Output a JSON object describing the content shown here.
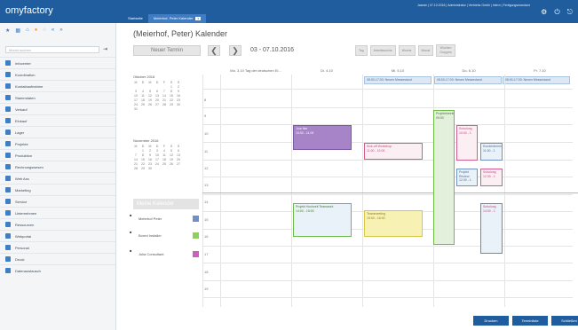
{
  "app": {
    "brand": "myfactory"
  },
  "topbar": {
    "tabs": [
      {
        "label": "Startseite",
        "active": false
      },
      {
        "label": "Meierhof, Peter Kalender",
        "active": true,
        "badge": "x"
      }
    ],
    "userinfo": "Jasmin | 07.10.2016 | Administrator | Vertriebs Gmbh | Intern | Fertigungsmandant",
    "icons": [
      "gear-icon",
      "power-icon",
      "exit-icon"
    ]
  },
  "sidebar": {
    "icons": [
      "star-icon",
      "bar-chart-icon",
      "home-icon",
      "palette-icon",
      "circle-icon",
      "prev-icon",
      "next-icon"
    ],
    "search_placeholder": "Modul suchen",
    "search_button": "⇥",
    "items": [
      "Infocenter",
      "Koordination",
      "Kontaktaufnahme",
      "Stammdaten",
      "Verkauf",
      "Einkauf",
      "Lager",
      "Projekte",
      "Produktion",
      "Rechnungswesen",
      "Web Ass",
      "Marketing",
      "Service",
      "Unternehmen",
      "Ressourcen",
      "Webportal",
      "Personal",
      "Druck",
      "Datenaustausch"
    ]
  },
  "header": {
    "title": "(Meierhof, Peter) Kalender",
    "new_appointment": "Neuer Termin",
    "prev": "❮",
    "next": "❯",
    "daterange": "03 - 07.10.2016",
    "views": [
      "Tag",
      "Arbeitswoche",
      "Woche",
      "Monat"
    ],
    "view_tall": [
      "Wochen",
      "Gruppen"
    ]
  },
  "mini_oct": {
    "title": "Oktober 2016",
    "weekdays": [
      "M",
      "D",
      "M",
      "D",
      "F",
      "S",
      "S"
    ],
    "rows": [
      [
        "",
        "",
        "",
        "",
        "",
        "1",
        "2"
      ],
      [
        "3",
        "4",
        "5",
        "6",
        "7",
        "8",
        "9"
      ],
      [
        "10",
        "11",
        "12",
        "13",
        "14",
        "15",
        "16"
      ],
      [
        "17",
        "18",
        "19",
        "20",
        "21",
        "22",
        "23"
      ],
      [
        "24",
        "25",
        "26",
        "27",
        "28",
        "29",
        "30"
      ],
      [
        "31",
        "",
        "",
        "",
        "",
        "",
        ""
      ]
    ]
  },
  "mini_nov": {
    "title": "November 2016",
    "weekdays": [
      "M",
      "D",
      "M",
      "D",
      "F",
      "S",
      "S"
    ],
    "rows": [
      [
        "",
        "1",
        "2",
        "3",
        "4",
        "5",
        "6"
      ],
      [
        "7",
        "8",
        "9",
        "10",
        "11",
        "12",
        "13"
      ],
      [
        "14",
        "15",
        "16",
        "17",
        "18",
        "19",
        "20"
      ],
      [
        "21",
        "22",
        "23",
        "24",
        "25",
        "26",
        "27"
      ],
      [
        "28",
        "29",
        "30",
        "",
        "",
        "",
        ""
      ]
    ]
  },
  "my_calendars": {
    "title": "Meine Kalender",
    "items": [
      {
        "name": "Meierhof Peter",
        "color": "#6f8fc8"
      },
      {
        "name": "Bored Installer",
        "color": "#8fcf5f"
      },
      {
        "name": "Julia Consultant",
        "color": "#cf5fbf"
      }
    ]
  },
  "days": [
    "Mo. 3.10 Tag der deutschen Ei...",
    "Di. 4.10",
    "Mi. 5.10",
    "Do. 6.10",
    "Fr. 7.10"
  ],
  "allday_events": [
    "08:00-17:00: Neuen Messestand",
    "08:00-17:00: Neuen Messestand",
    "08:00-17:00: Neuen Messestand"
  ],
  "hours": [
    "8",
    "9",
    "10",
    "11",
    "12",
    "13",
    "14",
    "15",
    "16",
    "17",
    "18",
    "19"
  ],
  "events": [
    {
      "title": "Jour fixe",
      "time": "10:00 - 11:00"
    },
    {
      "title": "Kick-off Workshop",
      "time": "11:00 - 12:00"
    },
    {
      "title": "Projektmeeting",
      "time": "09:00"
    },
    {
      "title": "Schulung",
      "time": "10:00 - 1"
    },
    {
      "title": "Kundentermin",
      "time": "11:00 - 1"
    },
    {
      "title": "Projekt Review",
      "time": "12:30 - 1"
    },
    {
      "title": "Schulung",
      "time": "12:30 - 1"
    },
    {
      "title": "Projekt Hochzeit Teamwork",
      "time": "14:00 - 15:00"
    },
    {
      "title": "Teammeeting",
      "time": "15:00 - 16:00"
    },
    {
      "title": "Schulung",
      "time": "14:00 - 1"
    }
  ],
  "footer": {
    "buttons": [
      "Drucken",
      "Terminliste",
      "Schließen"
    ]
  }
}
